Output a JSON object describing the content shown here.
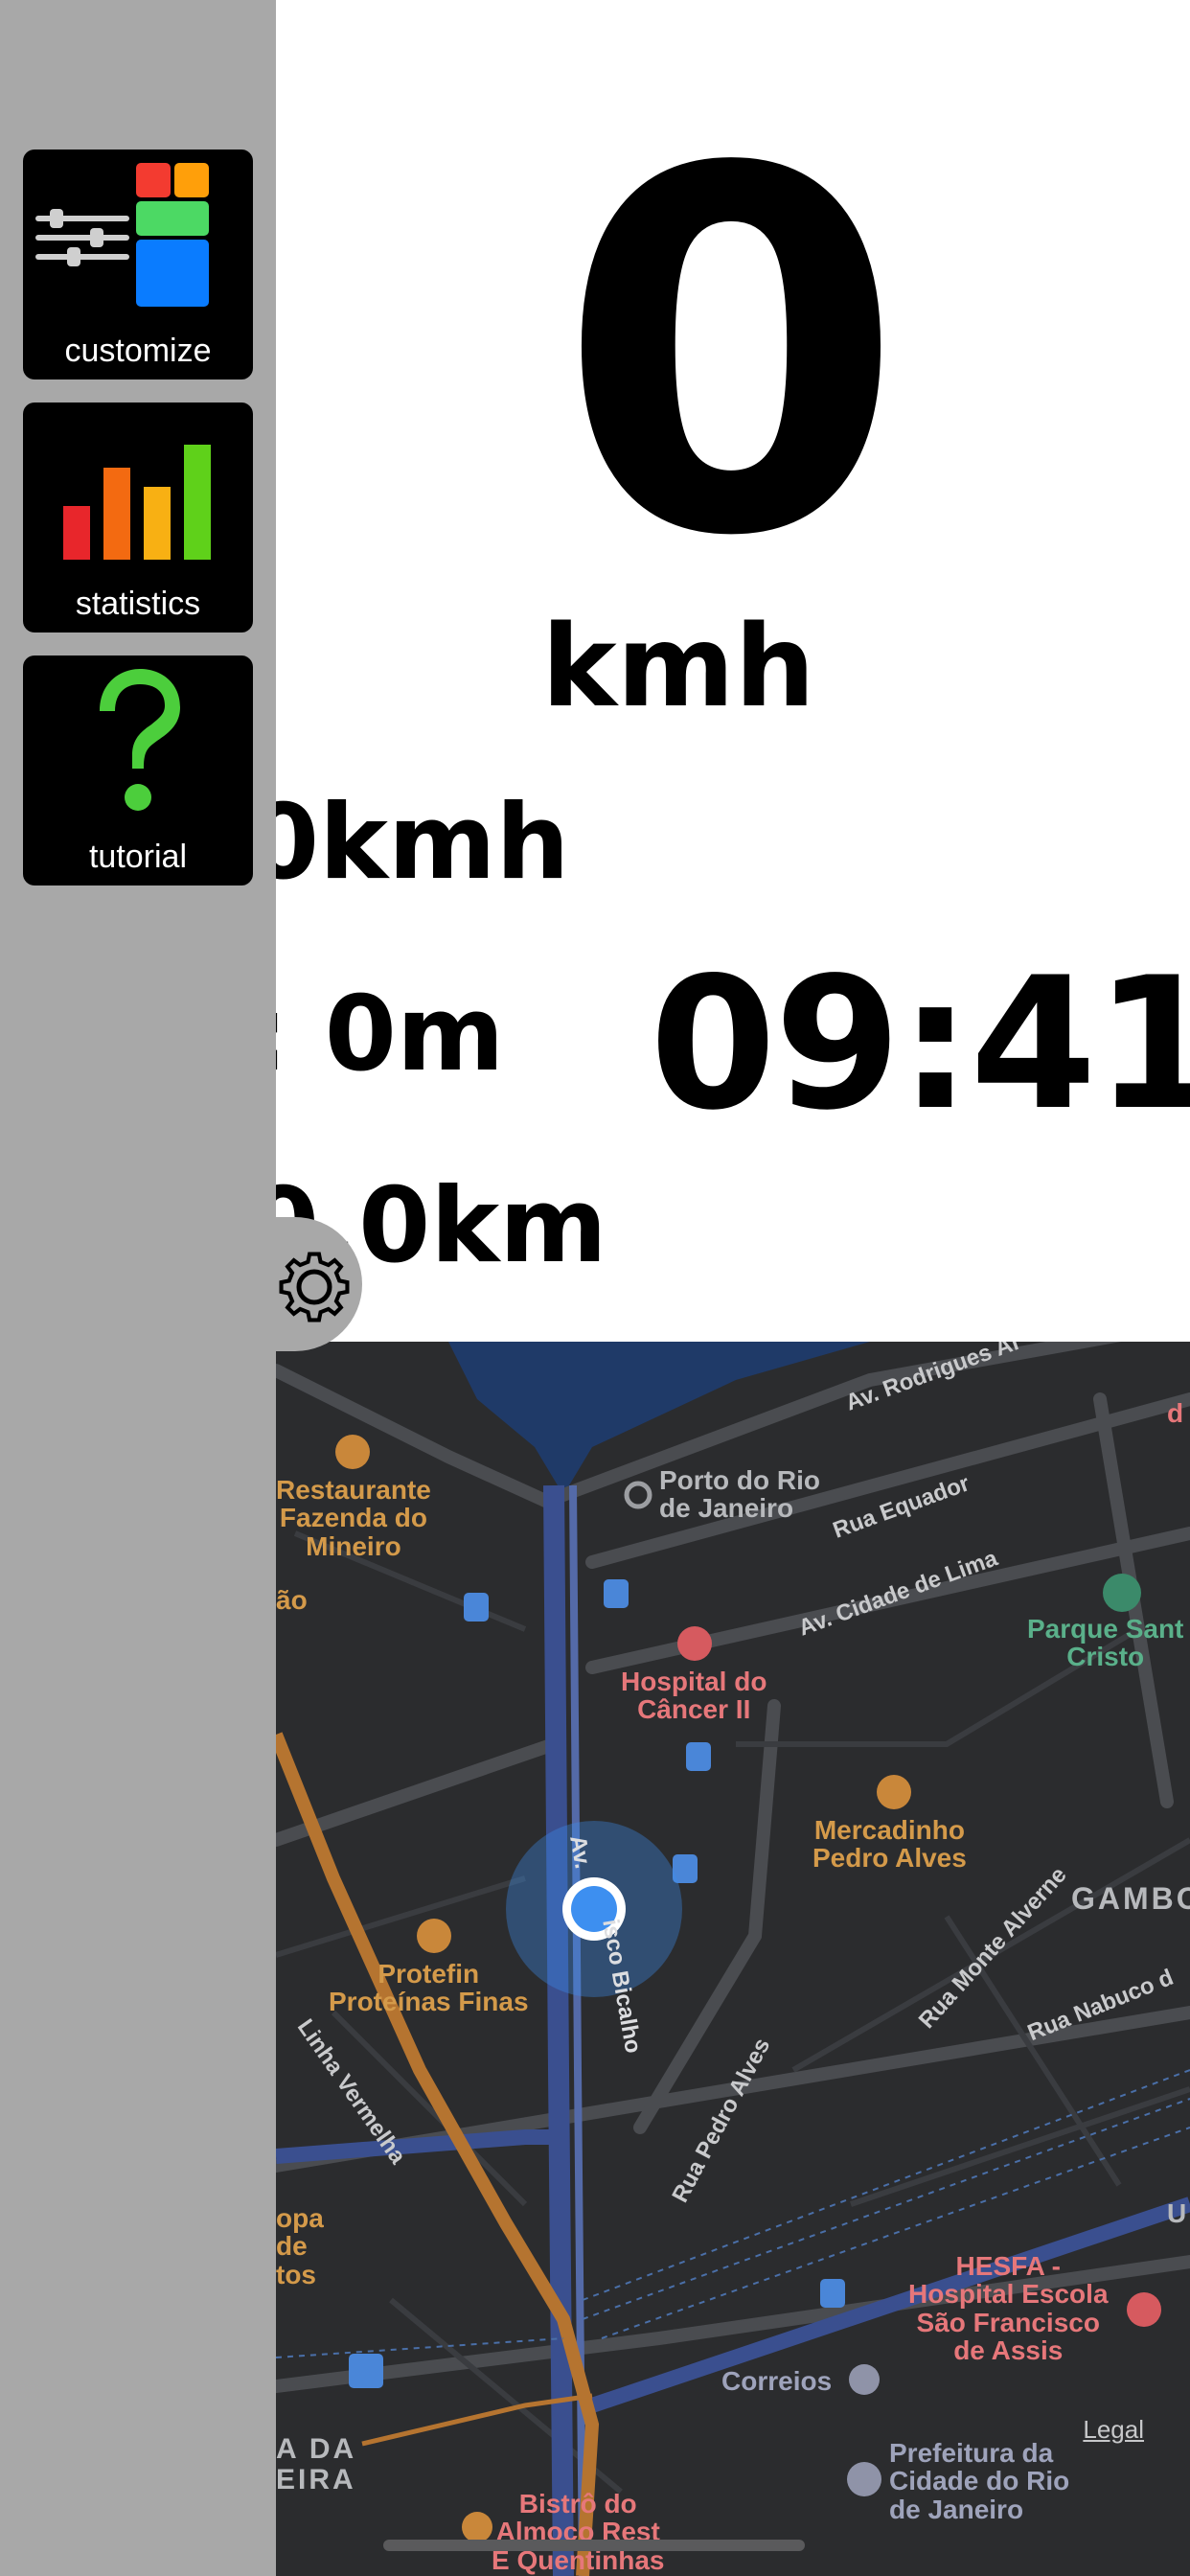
{
  "speedometer": {
    "speed_value": "0",
    "speed_unit": "kmh",
    "max_speed": "0kmh",
    "altitude": ": 0m",
    "distance": "0.0km",
    "clock": "09:41"
  },
  "sidebar": {
    "items": [
      {
        "label": "customize",
        "icon": "sliders-icon"
      },
      {
        "label": "statistics",
        "icon": "bar-chart-icon"
      },
      {
        "label": "tutorial",
        "icon": "question-icon"
      }
    ],
    "settings_icon": "gear-icon"
  },
  "map": {
    "legal": "Legal",
    "labels": {
      "rodrigues": "Av. Rodrigues Al",
      "porto": "Porto do Rio\nde Janeiro",
      "restaurante": "Restaurante\nFazenda do\nMineiro",
      "rua_equador": "Rua Equador",
      "cidade_lima": "Av. Cidade de Lima",
      "parque": "Parque Sant\nCristo",
      "hospital_cancer": "Hospital do\nCâncer II",
      "mercadinho": "Mercadinho\nPedro Alves",
      "gamboa": "GAMBO",
      "protefin": "Protefin\nProteínas Finas",
      "francisco": "isco Bicalho",
      "av": "Av.",
      "linha_vermelha": "Linha Vermelha",
      "rua_pedro_alves": "Rua Pedro Alves",
      "rua_monte_alverne": "Rua Monte Alverne",
      "rua_nabuco": "Rua Nabuco d",
      "hesfa": "HESFA -\nHospital Escola\nSão Francisco\nde Assis",
      "correios": "Correios",
      "prefeitura": "Prefeitura da\nCidade do Rio\nde Janeiro",
      "bistro": "Bistrô do\nAlmoço Rest\nE Quentinhas",
      "opa": "opa\nde\ntos",
      "da_eira": "A DA\nEIRA",
      "ao": "ão",
      "d_right": "d",
      "u_right": "U"
    }
  },
  "colors": {
    "sidebar_bg": "#a8a8a8",
    "map_bg": "#2b2c2e",
    "location_blue": "#3d8ff0"
  }
}
